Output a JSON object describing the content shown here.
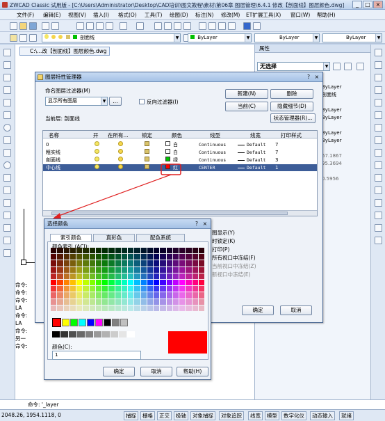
{
  "window": {
    "title": "ZWCAD Classic 试用版 - [C:\\Users\\Administrator\\Desktop\\CAD培训\\图文教程\\素材\\第06章 图层管理\\6.4.1 修改【剖面线】图层颜色.dwg]",
    "minimize": "_",
    "maximize": "□",
    "close": "×"
  },
  "menu": [
    "文件(F)",
    "编辑(E)",
    "视图(V)",
    "插入(I)",
    "格式(O)",
    "工具(T)",
    "绘图(D)",
    "标注(N)",
    "修改(M)",
    "ET扩展工具(X)",
    "窗口(W)",
    "帮助(H)"
  ],
  "toolbar2": {
    "layer_combo": "剖面线",
    "color_combo": "ByLayer",
    "linetype_combo": "ByLayer",
    "lineweight_combo": "ByLayer"
  },
  "doc_tab": "C:\\...改【剖面线】图层颜色.dwg",
  "props_panel": {
    "title": "属性",
    "selection": "无选择",
    "rows": [
      "ByLayer",
      "剖面线",
      "",
      "ByLayer",
      "ByLayer",
      "",
      "ByLayer",
      "ByLayer",
      "",
      "67.1867",
      "95.3694",
      "",
      "0.5956"
    ],
    "partial_labels": [
      "图显示(Y)",
      "时锁定(K)",
      "打印(P)",
      "所有视口中冻结(F)",
      "当前视口中冻结(Z)",
      "新视口中冻结(E)"
    ]
  },
  "command_history": [
    "命令:",
    "命令:",
    "命令:",
    "LA",
    "命令:",
    "LA",
    "命令:",
    "另一",
    "命令:"
  ],
  "command_line": "命令: '_layer",
  "status": {
    "coords": "2048.26,  1954.1118,  0",
    "buttons": [
      "捕捉",
      "栅格",
      "正交",
      "极轴",
      "对象捕捉",
      "对象追踪",
      "线宽",
      "模型",
      "数字化仪",
      "动态输入",
      "就绪"
    ]
  },
  "layer_dialog": {
    "title": "图层特性管理器",
    "help": "?",
    "close": "×",
    "filter_label": "命名图层过滤器(M)",
    "filter_value": "显示所有图层",
    "filter_btn": "...",
    "invert_label": "反向过滤器(I)",
    "current_label": "当前层: 剖面线",
    "btn_new": "新建(N)",
    "btn_delete": "删除",
    "btn_current": "当前(C)",
    "btn_hide": "隐藏细节(D)",
    "btn_state": "状态管理器(R)...",
    "btn_ok": "确定",
    "btn_cancel": "取消",
    "columns": [
      "名称",
      "开",
      "在所有...",
      "锁定",
      "颜色",
      "线型",
      "线宽",
      "打印样式"
    ],
    "rows": [
      {
        "name": "0",
        "color_name": "白",
        "color": "#ffffff",
        "linetype": "Continuous",
        "lineweight": "Default",
        "plot": "7"
      },
      {
        "name": "粗实线",
        "color_name": "白",
        "color": "#ffffff",
        "linetype": "Continuous",
        "lineweight": "Default",
        "plot": "7"
      },
      {
        "name": "剖面线",
        "color_name": "绿",
        "color": "#00c000",
        "linetype": "Continuous",
        "lineweight": "Default",
        "plot": "3"
      },
      {
        "name": "中心线",
        "color_name": "红",
        "color": "#ff0000",
        "linetype": "CENTER",
        "lineweight": "Default",
        "plot": "1"
      }
    ]
  },
  "color_dialog": {
    "title": "选择颜色",
    "help": "?",
    "close": "×",
    "tabs": [
      "索引颜色",
      "真彩色",
      "配色系统"
    ],
    "group_label": "颜色索引 (ACI):",
    "color_label": "颜色(C):",
    "color_value": "1",
    "btn_ok": "确定",
    "btn_cancel": "取消",
    "btn_help": "帮助(H)",
    "selected_color": "#ff0000",
    "standard_colors": [
      "#ff0000",
      "#ffff00",
      "#00ff00",
      "#00ffff",
      "#0000ff",
      "#ff00ff",
      "#000000",
      "#808080",
      "#c0c0c0"
    ],
    "gray_ramp": [
      "#000000",
      "#333333",
      "#505050",
      "#696969",
      "#808080",
      "#999999",
      "#b2b2b2",
      "#cccccc",
      "#e5e5e5",
      "#ffffff"
    ]
  },
  "accent": {
    "highlight": "#3d5d98",
    "annotation": "#e02020"
  }
}
